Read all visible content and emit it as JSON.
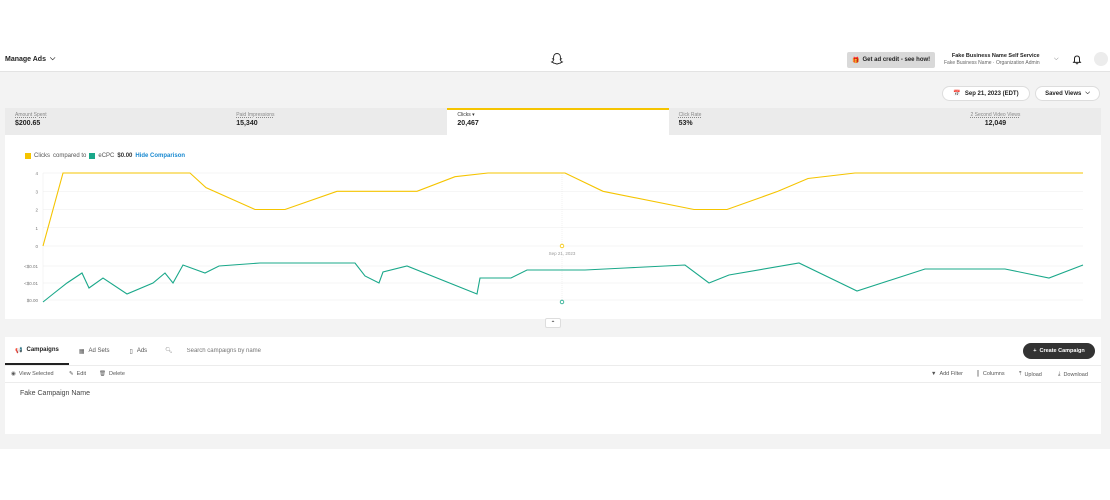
{
  "header": {
    "manage_ads": "Manage Ads",
    "credit_label": "Get ad credit - see how!",
    "business_name": "Fake Business Name Self Service",
    "business_role": "Fake Business Name · Organization Admin"
  },
  "toolbar_top": {
    "date": "Sep 21, 2023 (EDT)",
    "saved_views": "Saved Views"
  },
  "metrics": [
    {
      "label": "Amount Spent",
      "value": "$200.65"
    },
    {
      "label": "Paid Impressions",
      "value": "15,340"
    },
    {
      "label": "Clicks",
      "value": "20,467"
    },
    {
      "label": "Click Rate",
      "value": "53%"
    },
    {
      "label": "2 Second Video Views",
      "value": "12,049"
    }
  ],
  "legend": {
    "primary": "Clicks",
    "compared_to": "compared to",
    "secondary": "eCPC",
    "secondary_value": "$0.00",
    "hide": "Hide Comparison"
  },
  "colors": {
    "clicks": "#f5c400",
    "ecpc": "#1aa88a"
  },
  "chart_data": {
    "type": "line",
    "crosshair_label": "Sep 21, 2023",
    "top": {
      "name": "Clicks",
      "y_ticks": [
        "4",
        "3",
        "2",
        "1",
        "0"
      ],
      "ylim": [
        0,
        4
      ],
      "values": [
        0,
        4,
        4,
        4,
        4,
        4,
        3.2,
        2,
        2,
        3,
        3,
        3,
        3.8,
        4,
        4,
        4,
        3,
        2,
        2,
        3,
        3.7,
        4,
        4,
        4,
        4,
        4,
        4,
        4,
        4
      ]
    },
    "bottom": {
      "name": "eCPC",
      "y_ticks": [
        "<$0.01",
        "<$0.01",
        "$0.00"
      ]
    }
  },
  "table": {
    "tabs": [
      "Campaigns",
      "Ad Sets",
      "Ads"
    ],
    "search_placeholder": "Search campaigns by name",
    "create_label": "Create Campaign",
    "actions": [
      "View Selected",
      "Edit",
      "Delete"
    ],
    "right_actions": [
      "Add Filter",
      "Columns",
      "Upload",
      "Download"
    ],
    "rows": [
      "Fake Campaign Name"
    ]
  }
}
